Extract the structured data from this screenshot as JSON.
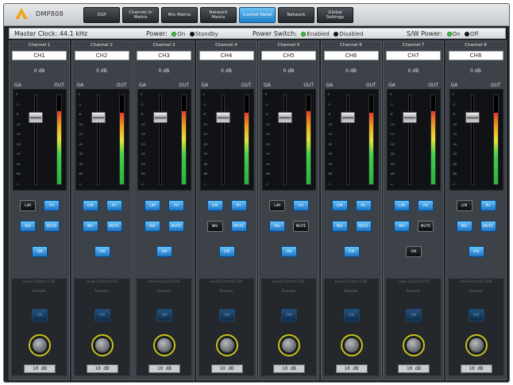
{
  "app": {
    "title": "DMP808",
    "logo_color": "#f0a31c"
  },
  "tabs": [
    {
      "label": "DSP",
      "active": false
    },
    {
      "label": "Channel In Matrix",
      "active": false
    },
    {
      "label": "Mix Matrix",
      "active": false
    },
    {
      "label": "Network Matrix",
      "active": false
    },
    {
      "label": "Control Panel",
      "active": true
    },
    {
      "label": "Network",
      "active": false
    },
    {
      "label": "Global Settings",
      "active": false
    }
  ],
  "status": {
    "master_clock_label": "Master Clock:",
    "master_clock_value": "44.1 kHz",
    "power_label": "Power:",
    "power_on": "On",
    "power_standby": "Standby",
    "switch_label": "Power Switch:",
    "switch_enabled": "Enabled",
    "switch_disabled": "Disabled",
    "sw_label": "S/W Power:",
    "sw_on": "On",
    "sw_off": "Off"
  },
  "common": {
    "gain_value": "0 dB",
    "ga_label": "GA",
    "out_label": "OUT",
    "scale_ticks": [
      "0",
      "-3",
      "-6",
      "-10",
      "-15",
      "-20",
      "-30",
      "-40",
      "-60",
      "-∞"
    ],
    "btn_lim": "LIM",
    "btn_phase": "PH",
    "btn_inv": "INV",
    "btn_mute": "MUTE",
    "btn_on": "ON",
    "lower_title": "Level Control",
    "lower_sub": "Remote",
    "lower_btn": "ON"
  },
  "channels": [
    {
      "header": "Channel 1",
      "name": "CH1",
      "lower_title": "Level Control CH1",
      "fader": 0.78,
      "meter": 0.82,
      "lim": false,
      "ph": true,
      "inv": true,
      "mute": true,
      "on": true,
      "knob_value": "10 dB"
    },
    {
      "header": "Channel 2",
      "name": "CH2",
      "lower_title": "Level Control CH2",
      "fader": 0.78,
      "meter": 0.8,
      "lim": true,
      "ph": true,
      "inv": true,
      "mute": true,
      "on": true,
      "knob_value": "10 dB"
    },
    {
      "header": "Channel 3",
      "name": "CH3",
      "lower_title": "Level Control CH3",
      "fader": 0.78,
      "meter": 0.82,
      "lim": true,
      "ph": true,
      "inv": true,
      "mute": true,
      "on": true,
      "knob_value": "10 dB"
    },
    {
      "header": "Channel 4",
      "name": "CH4",
      "lower_title": "Level Control CH4",
      "fader": 0.78,
      "meter": 0.8,
      "lim": true,
      "ph": true,
      "inv": false,
      "mute": true,
      "on": true,
      "knob_value": "10 dB"
    },
    {
      "header": "Channel 5",
      "name": "CH5",
      "lower_title": "Level Control CH5",
      "fader": 0.78,
      "meter": 0.82,
      "lim": false,
      "ph": true,
      "inv": true,
      "mute": false,
      "on": true,
      "knob_value": "10 dB"
    },
    {
      "header": "Channel 6",
      "name": "CH6",
      "lower_title": "Level Control CH6",
      "fader": 0.78,
      "meter": 0.8,
      "lim": true,
      "ph": true,
      "inv": true,
      "mute": true,
      "on": true,
      "knob_value": "10 dB"
    },
    {
      "header": "Channel 7",
      "name": "CH7",
      "lower_title": "Level Control CH7",
      "fader": 0.78,
      "meter": 0.82,
      "lim": true,
      "ph": true,
      "inv": true,
      "mute": false,
      "on": false,
      "knob_value": "10 dB"
    },
    {
      "header": "Channel 8",
      "name": "CH8",
      "lower_title": "Level Control CH8",
      "fader": 0.78,
      "meter": 0.8,
      "lim": false,
      "ph": true,
      "inv": true,
      "mute": true,
      "on": true,
      "knob_value": "10 dB"
    }
  ],
  "colors": {
    "accent": "#1e7fc7",
    "led_green": "#39c43a",
    "knob_ring": "#c6c21c"
  }
}
